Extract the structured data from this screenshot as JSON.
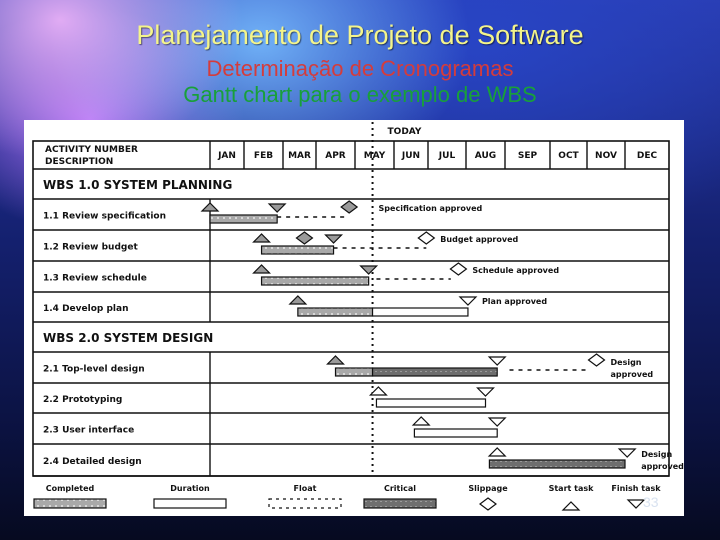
{
  "slide": {
    "title": "Planejamento de Projeto de Software",
    "subtitle": "Determinação de Cronogramas",
    "subtitle2": "Gantt chart para o exemplo de WBS",
    "page_number": "33",
    "colors": {
      "title": "#f4f48a",
      "subtitle": "#d43c3c",
      "subtitle2": "#18a03a"
    }
  },
  "chart_data": {
    "type": "gantt",
    "title": "Gantt chart para o exemplo de WBS",
    "header": {
      "activity_label_line1": "ACTIVITY NUMBER",
      "activity_label_line2": "DESCRIPTION",
      "today_label": "TODAY"
    },
    "months": [
      "JAN",
      "FEB",
      "MAR",
      "APR",
      "MAY",
      "JUN",
      "JUL",
      "AUG",
      "SEP",
      "OCT",
      "NOV",
      "DEC"
    ],
    "today_month": 4.45,
    "rows": [
      {
        "type": "group",
        "label": "WBS 1.0  SYSTEM PLANNING"
      },
      {
        "type": "task",
        "label": "1.1 Review specification",
        "bars": [
          {
            "kind": "completed",
            "start": 0.0,
            "end": 1.85
          }
        ],
        "start_marker": 0.0,
        "finish_marker": 1.85,
        "float": {
          "start": 1.85,
          "end": 3.85
        },
        "slippage": 3.85,
        "milestone_label": "Specification approved"
      },
      {
        "type": "task",
        "label": "1.2 Review budget",
        "bars": [
          {
            "kind": "completed",
            "start": 1.45,
            "end": 3.45
          }
        ],
        "start_marker": 1.45,
        "finish_marker": 3.45,
        "float": {
          "start": 3.45,
          "end": 5.95
        },
        "slippage_early": 2.65,
        "slippage": 5.95,
        "milestone_label": "Budget approved"
      },
      {
        "type": "task",
        "label": "1.3 Review schedule",
        "bars": [
          {
            "kind": "completed",
            "start": 1.45,
            "end": 4.35
          }
        ],
        "start_marker": 1.45,
        "finish_marker": 4.35,
        "float": {
          "start": 4.55,
          "end": 6.6
        },
        "slippage": 6.8,
        "milestone_label": "Schedule approved"
      },
      {
        "type": "task",
        "label": "1.4 Develop plan",
        "bars": [
          {
            "kind": "completed",
            "start": 2.45,
            "end": 4.45
          },
          {
            "kind": "duration",
            "start": 4.45,
            "end": 7.05
          }
        ],
        "start_marker": 2.45,
        "finish_marker": 7.05,
        "milestone_label": "Plan approved"
      },
      {
        "type": "group",
        "label": "WBS 2.0  SYSTEM DESIGN"
      },
      {
        "type": "task",
        "label": "2.1 Top-level design",
        "bars": [
          {
            "kind": "completed",
            "start": 3.5,
            "end": 4.45
          },
          {
            "kind": "critical",
            "start": 4.45,
            "end": 7.8
          }
        ],
        "start_marker": 3.5,
        "finish_marker": 7.8,
        "float": {
          "start": 8.1,
          "end": 10.0
        },
        "slippage": 10.25,
        "milestone_label": "Design approved"
      },
      {
        "type": "task",
        "label": "2.2 Prototyping",
        "bars": [
          {
            "kind": "duration",
            "start": 4.55,
            "end": 7.5
          }
        ],
        "start_marker": 4.6,
        "finish_marker": 7.5
      },
      {
        "type": "task",
        "label": "2.3 User interface",
        "bars": [
          {
            "kind": "duration",
            "start": 5.6,
            "end": 7.8
          }
        ],
        "start_marker": 5.8,
        "finish_marker": 7.8
      },
      {
        "type": "task",
        "label": "2.4 Detailed design",
        "bars": [
          {
            "kind": "critical",
            "start": 7.6,
            "end": 11.0
          }
        ],
        "start_marker": 7.8,
        "finish_marker": 11.05,
        "milestone_label": "Design approved"
      }
    ],
    "legend": [
      {
        "key": "completed",
        "label": "Completed"
      },
      {
        "key": "duration",
        "label": "Duration"
      },
      {
        "key": "float",
        "label": "Float"
      },
      {
        "key": "critical",
        "label": "Critical"
      },
      {
        "key": "slippage",
        "label": "Slippage"
      },
      {
        "key": "start",
        "label": "Start task"
      },
      {
        "key": "finish",
        "label": "Finish task"
      }
    ]
  }
}
